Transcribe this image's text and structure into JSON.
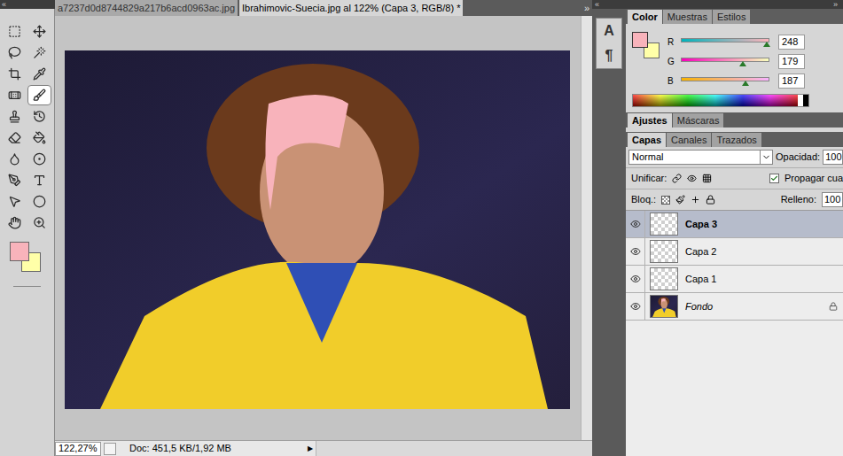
{
  "toolbar": {
    "header": "«",
    "tools": [
      {
        "selected": false
      },
      {
        "selected": false
      },
      {
        "selected": false
      },
      {
        "selected": false
      },
      {
        "selected": false
      },
      {
        "selected": false
      },
      {
        "selected": false
      },
      {
        "selected": true
      },
      {
        "selected": false
      },
      {
        "selected": false
      },
      {
        "selected": false
      },
      {
        "selected": false
      },
      {
        "selected": false
      },
      {
        "selected": false
      },
      {
        "selected": false
      },
      {
        "selected": false
      },
      {
        "selected": false
      },
      {
        "selected": false
      },
      {
        "selected": false
      },
      {
        "selected": false
      }
    ],
    "foreground": "#f8b3bb",
    "background": "#ffffa8"
  },
  "document_tabs": [
    {
      "label": "a7237d0d8744829a217b6acd0963ac.jpg",
      "selected": false
    },
    {
      "label": "Ibrahimovic-Suecia.jpg al 122% (Capa 3, RGB/8) *",
      "selected": true
    }
  ],
  "tabs_overflow": "»",
  "dock": {
    "header": "«",
    "items": [
      "A",
      "¶"
    ]
  },
  "panel_header": "»",
  "color_panel": {
    "tabs": [
      {
        "label": "Color",
        "selected": true
      },
      {
        "label": "Muestras",
        "selected": false
      },
      {
        "label": "Estilos",
        "selected": false
      }
    ],
    "foreground": "#f8b3bb",
    "background": "#ffffa8",
    "channels": [
      {
        "name": "R",
        "value": "248",
        "level": 0.97
      },
      {
        "name": "G",
        "value": "179",
        "level": 0.7
      },
      {
        "name": "B",
        "value": "187",
        "level": 0.73
      }
    ]
  },
  "adjust_tabs": [
    {
      "label": "Ajustes",
      "selected": true
    },
    {
      "label": "Máscaras",
      "selected": false
    }
  ],
  "layers_panel": {
    "tabs": [
      {
        "label": "Capas",
        "selected": true
      },
      {
        "label": "Canales",
        "selected": false
      },
      {
        "label": "Trazados",
        "selected": false
      }
    ],
    "blend_mode": "Normal",
    "opacity_label": "Opacidad:",
    "opacity": "100",
    "unify_label": "Unificar:",
    "propagate": {
      "label": "Propagar cua",
      "checked": true
    },
    "lock_label": "Bloq.:",
    "fill_label": "Relleno:",
    "fill": "100",
    "layers": [
      {
        "name": "Capa 3",
        "selected": true,
        "visible": true,
        "kind": "transparent",
        "locked": false
      },
      {
        "name": "Capa 2",
        "selected": false,
        "visible": true,
        "kind": "transparent",
        "locked": false
      },
      {
        "name": "Capa 1",
        "selected": false,
        "visible": true,
        "kind": "transparent",
        "locked": false
      },
      {
        "name": "Fondo",
        "selected": false,
        "visible": true,
        "kind": "background",
        "locked": true
      }
    ]
  },
  "status_bar": {
    "zoom": "122,27%",
    "doc": "Doc: 451,5 KB/1,92 MB",
    "arrow": "▶"
  }
}
